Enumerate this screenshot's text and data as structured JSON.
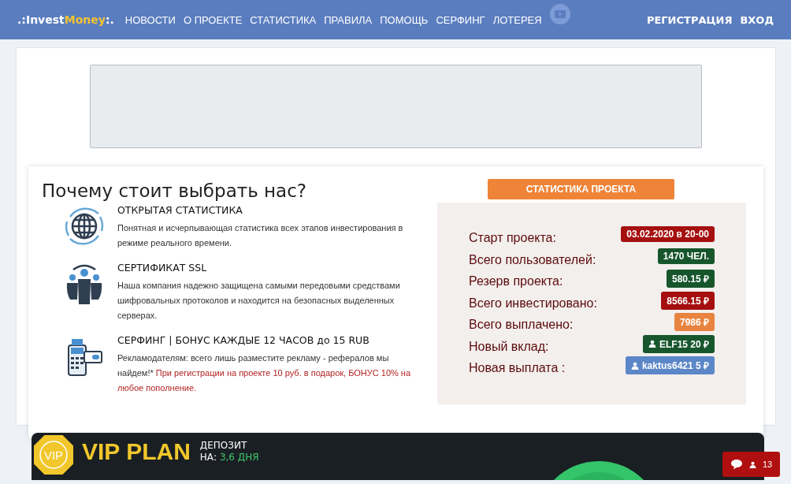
{
  "header": {
    "logo": {
      "prefix": ".:Invest",
      "accent": "Money",
      "suffix": ":."
    },
    "nav": [
      {
        "label": "НОВОСТИ"
      },
      {
        "label": "О ПРОЕКТЕ"
      },
      {
        "label": "СТАТИСТИКА"
      },
      {
        "label": "ПРАВИЛА"
      },
      {
        "label": "ПОМОЩЬ"
      },
      {
        "label": "СЕРФИНГ"
      },
      {
        "label": "ЛОТЕРЕЯ"
      }
    ],
    "auth": [
      {
        "label": "РЕГИСТРАЦИЯ"
      },
      {
        "label": "ВХОД"
      }
    ]
  },
  "why": {
    "title": "Почему стоит выбрать нас?",
    "features": [
      {
        "kind": "globe",
        "title": "ОТКРЫТАЯ СТАТИСТИКА",
        "text": "Понятная и исчерпывающая статистика всех этапов инвестирования в режиме реального времени."
      },
      {
        "kind": "people",
        "title": "СЕРТИФИКАТ SSL",
        "text": "Наша компания надежно защищена самыми передовыми средствами шифровальных протоколов и находится на безопасных выделенных серверах."
      },
      {
        "kind": "terminal",
        "title": "СЕРФИНГ | БОНУС КАЖДЫЕ 12 ЧАСОВ до 15 RUB",
        "text": "Рекламодателям: всего лишь разместите рекламу - рефералов мы найдем!*",
        "note": "При регистрации на проекте 10 руб. в подарок, БОНУС 10% на любое пополнение."
      }
    ]
  },
  "stats": {
    "title": "СТАТИСТИКА ПРОЕКТА",
    "rows": [
      {
        "label": "Старт проекта:",
        "value": "03.02.2020 в 20-00",
        "color": "#a50f0f",
        "kind": "plain"
      },
      {
        "label": "Всего пользователей:",
        "value": "1470 ЧЕЛ.",
        "color": "#17562c",
        "kind": "plain"
      },
      {
        "label": "Резерв проекта:",
        "value": "580.15 ₽",
        "color": "#17562c",
        "kind": "plain"
      },
      {
        "label": "Всего инвестировано:",
        "value": "8566.15 ₽",
        "color": "#a50f0f",
        "kind": "plain"
      },
      {
        "label": "Всего выплачено:",
        "value": "7986 ₽",
        "color": "#e8843f",
        "kind": "plain"
      },
      {
        "label": "Новый вклад:",
        "value": "ELF15 20 ₽",
        "color": "#17562c",
        "kind": "user"
      },
      {
        "label": "Новая выплата :",
        "value": "kaktus6421 5 ₽",
        "color": "#5b87c8",
        "kind": "user"
      }
    ]
  },
  "vip": {
    "badge": "VIP",
    "title": "VIP PLAN",
    "deposit": "ДЕПОЗИТ",
    "on": "НА:",
    "days": "3,6 ДНЯ"
  },
  "chat": {
    "count": "13"
  }
}
